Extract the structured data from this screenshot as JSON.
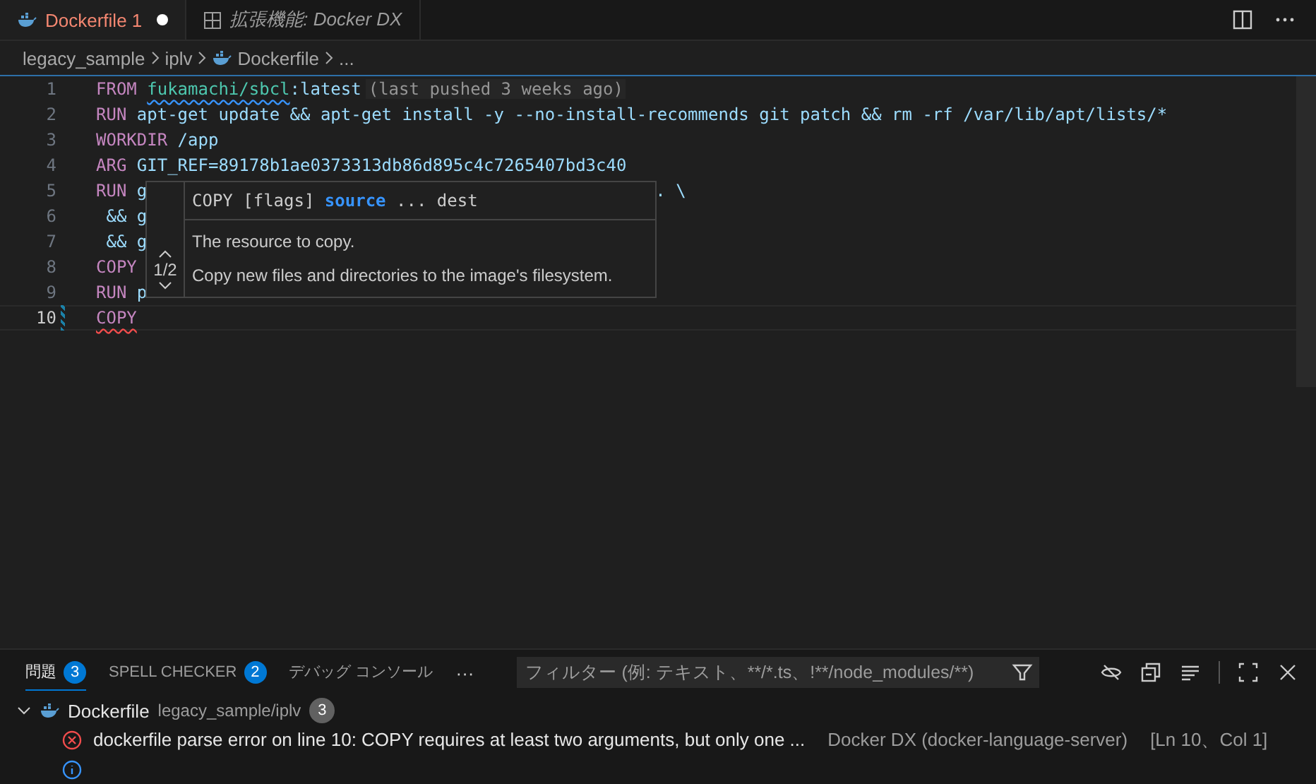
{
  "tabs": [
    {
      "label": "Dockerfile 1",
      "kind": "file",
      "selected": true,
      "modified": true
    },
    {
      "label": "拡張機能: Docker DX",
      "kind": "extension",
      "selected": false,
      "modified": false
    }
  ],
  "breadcrumb": [
    "legacy_sample",
    "iplv",
    "Dockerfile",
    "..."
  ],
  "code": [
    {
      "number": "1",
      "active": false,
      "tokens": [
        {
          "text": "FROM ",
          "kind": "keyword"
        },
        {
          "text": "fukamachi/sbcl",
          "kind": "image-warn"
        },
        {
          "text": ":latest",
          "kind": "plain"
        }
      ],
      "hint": "(last pushed 3 weeks ago)"
    },
    {
      "number": "2",
      "active": false,
      "tokens": [
        {
          "text": "RUN",
          "kind": "keyword"
        },
        {
          "text": " apt-get update && apt-get install -y --no-install-recommends git patch && rm -rf /var/lib/apt/lists/*",
          "kind": "plain"
        }
      ]
    },
    {
      "number": "3",
      "active": false,
      "tokens": [
        {
          "text": "WORKDIR",
          "kind": "keyword"
        },
        {
          "text": " /app",
          "kind": "plain"
        }
      ]
    },
    {
      "number": "4",
      "active": false,
      "tokens": [
        {
          "text": "ARG",
          "kind": "keyword"
        },
        {
          "text": " GIT_REF=89178b1ae0373313db86d895c4c7265407bd3c40",
          "kind": "plain"
        }
      ]
    },
    {
      "number": "5",
      "active": false,
      "tokens": [
        {
          "text": "RUN",
          "kind": "keyword"
        },
        {
          "text": " g",
          "kind": "plain"
        }
      ],
      "tail": ". \\"
    },
    {
      "number": "6",
      "active": false,
      "tokens": [
        {
          "text": " && g",
          "kind": "plain"
        }
      ]
    },
    {
      "number": "7",
      "active": false,
      "tokens": [
        {
          "text": " && g",
          "kind": "plain"
        }
      ]
    },
    {
      "number": "8",
      "active": false,
      "tokens": [
        {
          "text": "COPY",
          "kind": "keyword"
        }
      ]
    },
    {
      "number": "9",
      "active": false,
      "tokens": [
        {
          "text": "RUN",
          "kind": "keyword"
        },
        {
          "text": " p",
          "kind": "plain"
        }
      ]
    },
    {
      "number": "10",
      "active": true,
      "tokens": [
        {
          "text": "COPY",
          "kind": "keyword-error"
        }
      ]
    }
  ],
  "hover": {
    "signature": [
      {
        "text": "COPY [flags] ",
        "active": false
      },
      {
        "text": "source",
        "active": true
      },
      {
        "text": " ... dest",
        "active": false
      }
    ],
    "counter": "1/2",
    "param_doc": "The resource to copy.",
    "doc": "Copy new files and directories to the image's filesystem."
  },
  "panel": {
    "tabs": [
      {
        "label": "問題",
        "badge": "3",
        "selected": true
      },
      {
        "label": "SPELL CHECKER",
        "badge": "2",
        "selected": false
      },
      {
        "label": "デバッグ コンソール",
        "selected": false
      }
    ],
    "more": "···",
    "filter": {
      "placeholder": "フィルター (例: テキスト、**/*.ts、!**/node_modules/**)"
    },
    "group": {
      "expanded": true,
      "file": "Dockerfile",
      "path": "legacy_sample/iplv",
      "count": "3"
    },
    "problems": [
      {
        "kind": "error",
        "message": "dockerfile parse error on line 10: COPY requires at least two arguments, but only one ...",
        "source": "Docker DX (docker-language-server)",
        "location": "[Ln 10、Col 1]"
      },
      {
        "kind": "info"
      }
    ]
  }
}
